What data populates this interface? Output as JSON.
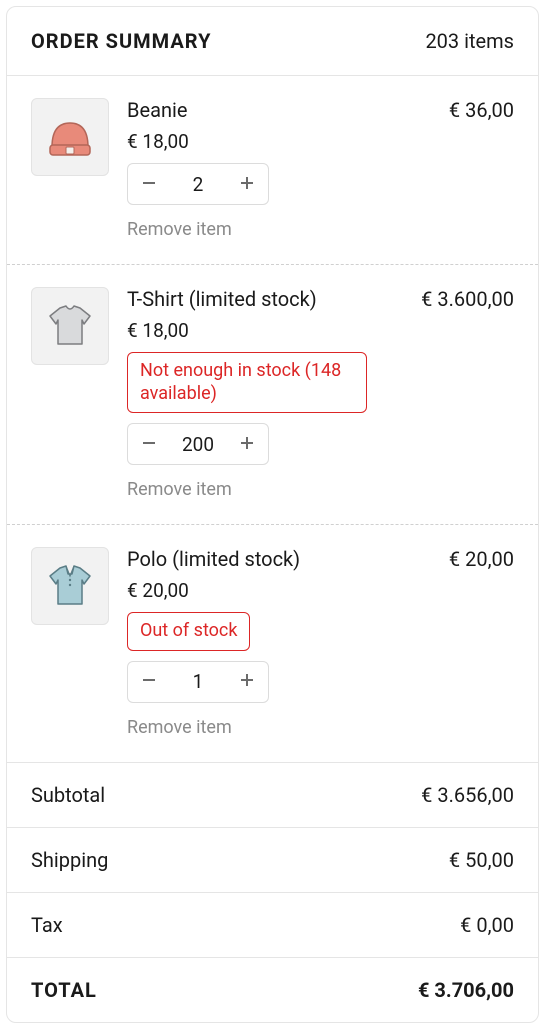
{
  "header": {
    "title": "ORDER SUMMARY",
    "count_text": "203 items"
  },
  "items": [
    {
      "icon": "beanie",
      "name": "Beanie",
      "unit_price": "€ 18,00",
      "quantity": "2",
      "line_total": "€ 36,00",
      "stock_warning": "",
      "remove_label": "Remove item"
    },
    {
      "icon": "tshirt",
      "name": "T-Shirt (limited stock)",
      "unit_price": "€ 18,00",
      "quantity": "200",
      "line_total": "€ 3.600,00",
      "stock_warning": "Not enough in stock (148 available)",
      "remove_label": "Remove item"
    },
    {
      "icon": "polo",
      "name": "Polo (limited stock)",
      "unit_price": "€ 20,00",
      "quantity": "1",
      "line_total": "€ 20,00",
      "stock_warning": "Out of stock",
      "remove_label": "Remove item"
    }
  ],
  "totals": {
    "subtotal_label": "Subtotal",
    "subtotal_value": "€ 3.656,00",
    "shipping_label": "Shipping",
    "shipping_value": "€ 50,00",
    "tax_label": "Tax",
    "tax_value": "€ 0,00",
    "total_label": "TOTAL",
    "total_value": "€ 3.706,00"
  }
}
